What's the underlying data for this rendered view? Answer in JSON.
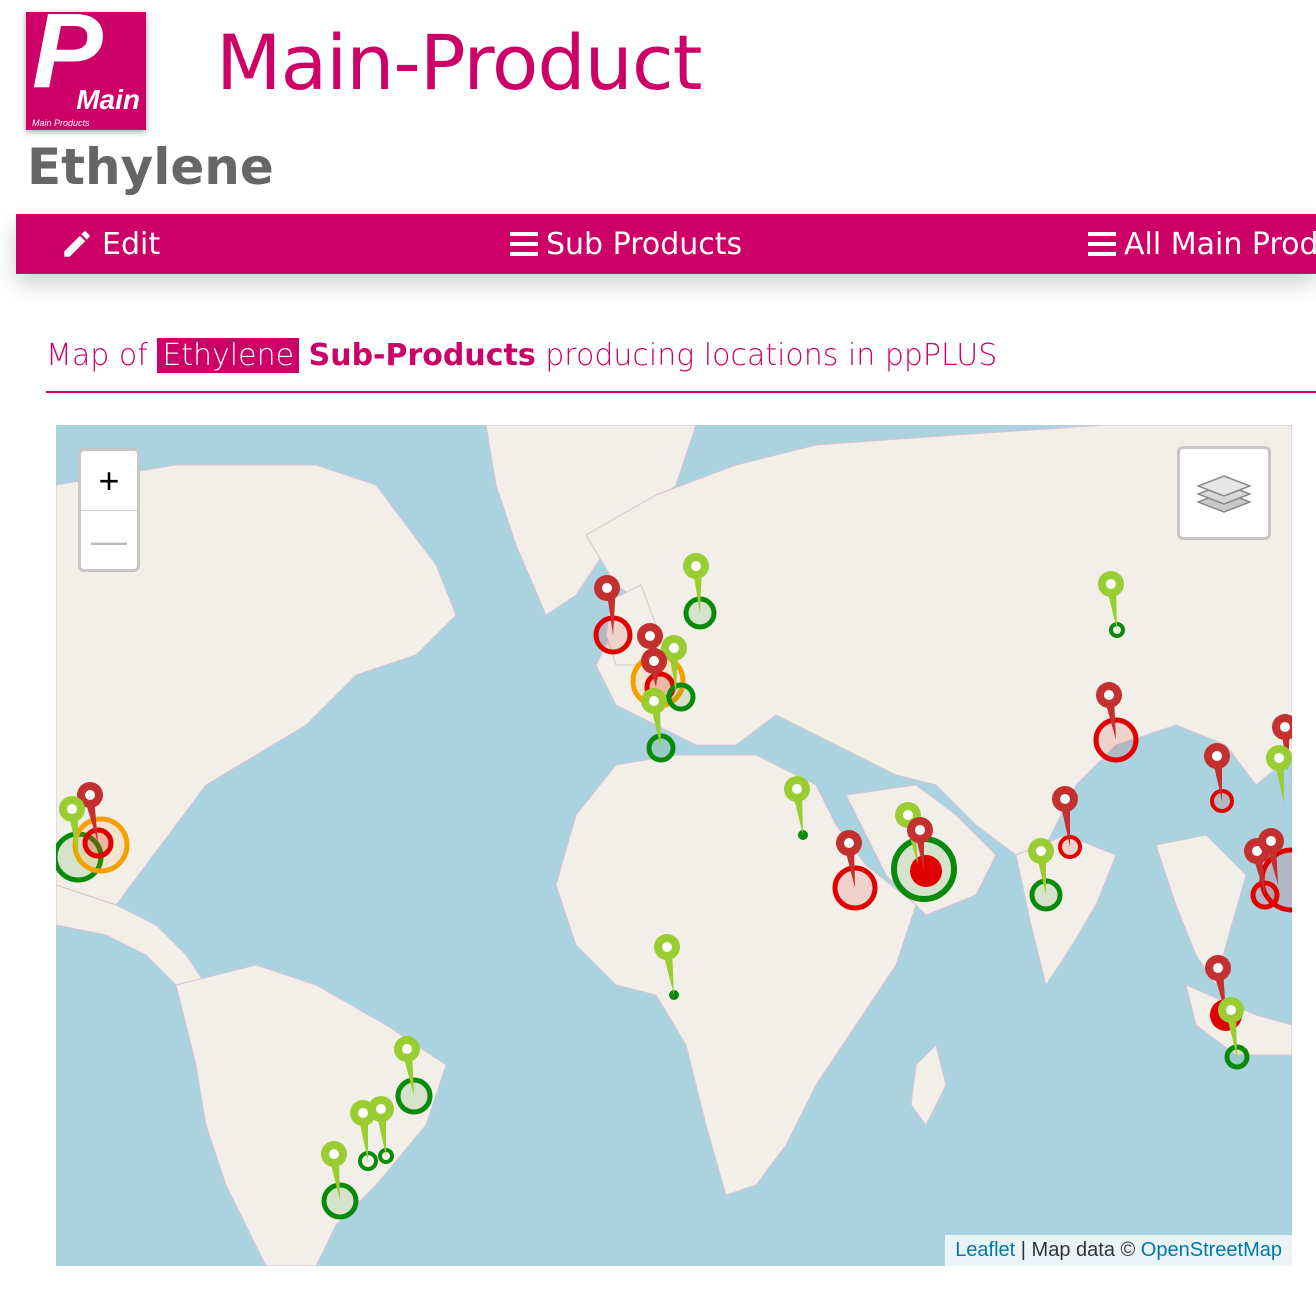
{
  "header": {
    "logo_letter": "P",
    "logo_word": "Main",
    "logo_caption": "Main Products",
    "title": "Main-Product",
    "subtitle": "Ethylene"
  },
  "nav": {
    "items": [
      {
        "label": "Edit",
        "icon": "pencil-icon"
      },
      {
        "label": "Sub Products",
        "icon": "menu-icon"
      },
      {
        "label": "All Main Prod",
        "icon": "menu-icon"
      }
    ]
  },
  "map_heading": {
    "prefix": "Map of ",
    "highlight": "Ethylene",
    "bold": "Sub-Products",
    "suffix": " producing locations in ppPLUS"
  },
  "map": {
    "zoom_in": "+",
    "zoom_out": "—",
    "layers_icon": "layers-icon",
    "attribution": {
      "leaflet": "Leaflet",
      "separator": " | Map data © ",
      "osm": "OpenStreetMap"
    },
    "colors": {
      "water": "#aad3df",
      "land": "#f2efe9",
      "red": "#e00000",
      "orange": "#f5a000",
      "green": "#0a8a0a",
      "light_green": "#9acd32"
    }
  }
}
